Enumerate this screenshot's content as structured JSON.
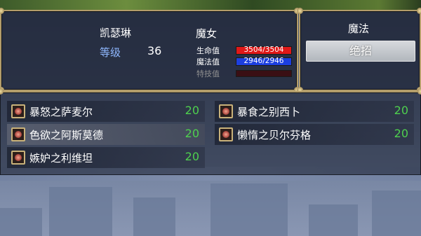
{
  "character": {
    "name": "凯瑟琳",
    "level_label": "等级",
    "level": "36",
    "class": "魔女"
  },
  "stats": {
    "hp_label": "生命值",
    "hp_text": "3504/3504",
    "hp_fraction": 1.0,
    "mp_label": "魔法值",
    "mp_text": "2946/2946",
    "mp_fraction": 1.0,
    "sp_label": "特技值",
    "sp_fraction": 0.0
  },
  "magic": {
    "title": "魔法",
    "ult_label": "绝招"
  },
  "skills": [
    {
      "name": "暴怒之萨麦尔",
      "value": "20"
    },
    {
      "name": "色欲之阿斯莫德",
      "value": "20"
    },
    {
      "name": "嫉妒之利维坦",
      "value": "20"
    },
    {
      "name": "暴食之别西卜",
      "value": "20"
    },
    {
      "name": "懒惰之贝尔芬格",
      "value": "20"
    }
  ],
  "colors": {
    "hp": "#e01818",
    "mp": "#1c3fe0",
    "sp": "#3a0f14",
    "frame": "#b39d6a",
    "skill_value": "#4ed04e",
    "level_label": "#8fb8ff"
  },
  "icons": {
    "skill": "sin-emblem-icon"
  }
}
